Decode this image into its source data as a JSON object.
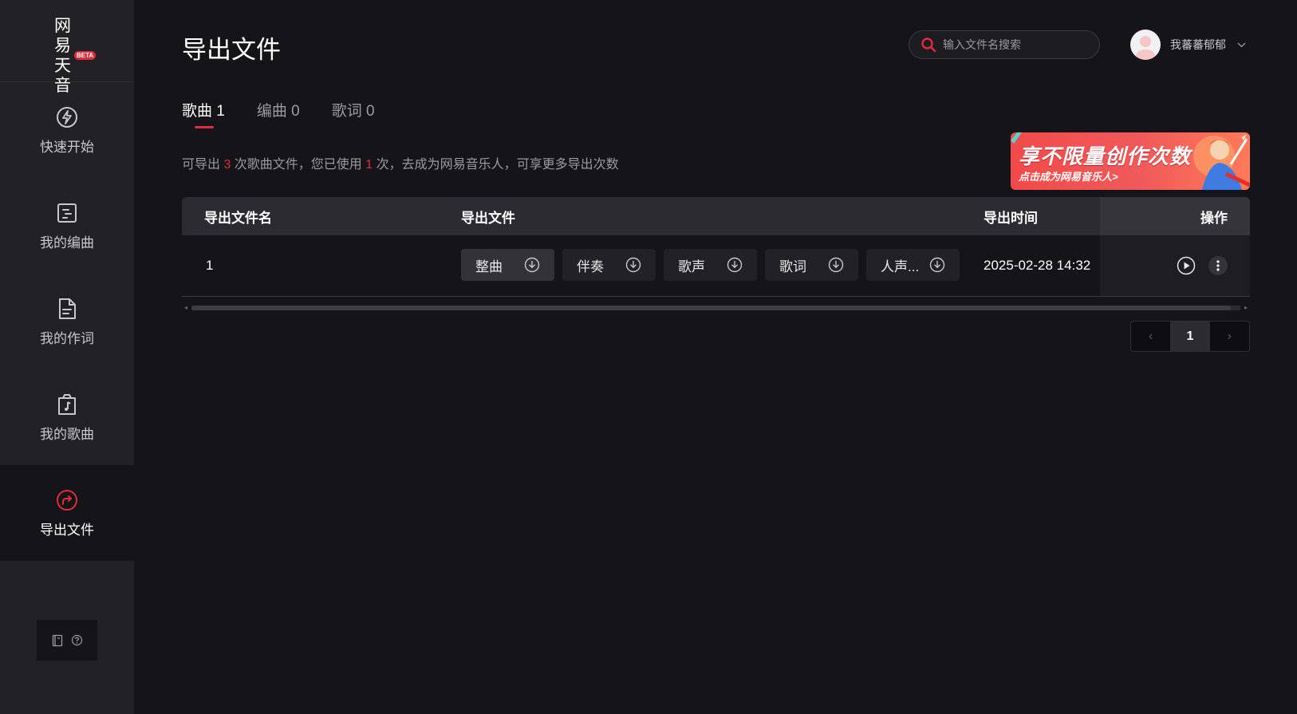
{
  "app": {
    "logo_text": "网易天音",
    "logo_badge": "BETA"
  },
  "sidebar": {
    "items": [
      {
        "label": "快速开始",
        "icon": "lightning-icon"
      },
      {
        "label": "我的编曲",
        "icon": "arrangement-icon"
      },
      {
        "label": "我的作词",
        "icon": "lyrics-doc-icon"
      },
      {
        "label": "我的歌曲",
        "icon": "music-note-icon"
      },
      {
        "label": "导出文件",
        "icon": "export-icon",
        "active": true
      }
    ],
    "footer_icons": [
      "manual-book-icon",
      "help-icon"
    ]
  },
  "header": {
    "title": "导出文件",
    "search_placeholder": "输入文件名搜索",
    "username": "我蕃蕃郁郁"
  },
  "tabs": [
    {
      "label": "歌曲",
      "count": "1",
      "active": true
    },
    {
      "label": "编曲",
      "count": "0"
    },
    {
      "label": "歌词",
      "count": "0"
    }
  ],
  "info": {
    "part1": "可导出 ",
    "limit": "3",
    "part2": " 次歌曲文件，您已使用 ",
    "used": "1",
    "part3": " 次，去成为网易音乐人，可享更多导出次数"
  },
  "banner": {
    "title": "享不限量创作次数",
    "subtitle": "点击成为网易音乐人>"
  },
  "table": {
    "headers": {
      "name": "导出文件名",
      "files": "导出文件",
      "time": "导出时间",
      "ops": "操作"
    },
    "rows": [
      {
        "name": "1",
        "files": [
          "整曲",
          "伴奏",
          "歌声",
          "歌词",
          "人声..."
        ],
        "time": "2025-02-28 14:32"
      }
    ]
  },
  "pagination": {
    "prev": "‹",
    "current": "1",
    "next": "›"
  },
  "colors": {
    "accent": "#e02b3a",
    "background": "#141419",
    "sidebar": "#212126"
  }
}
